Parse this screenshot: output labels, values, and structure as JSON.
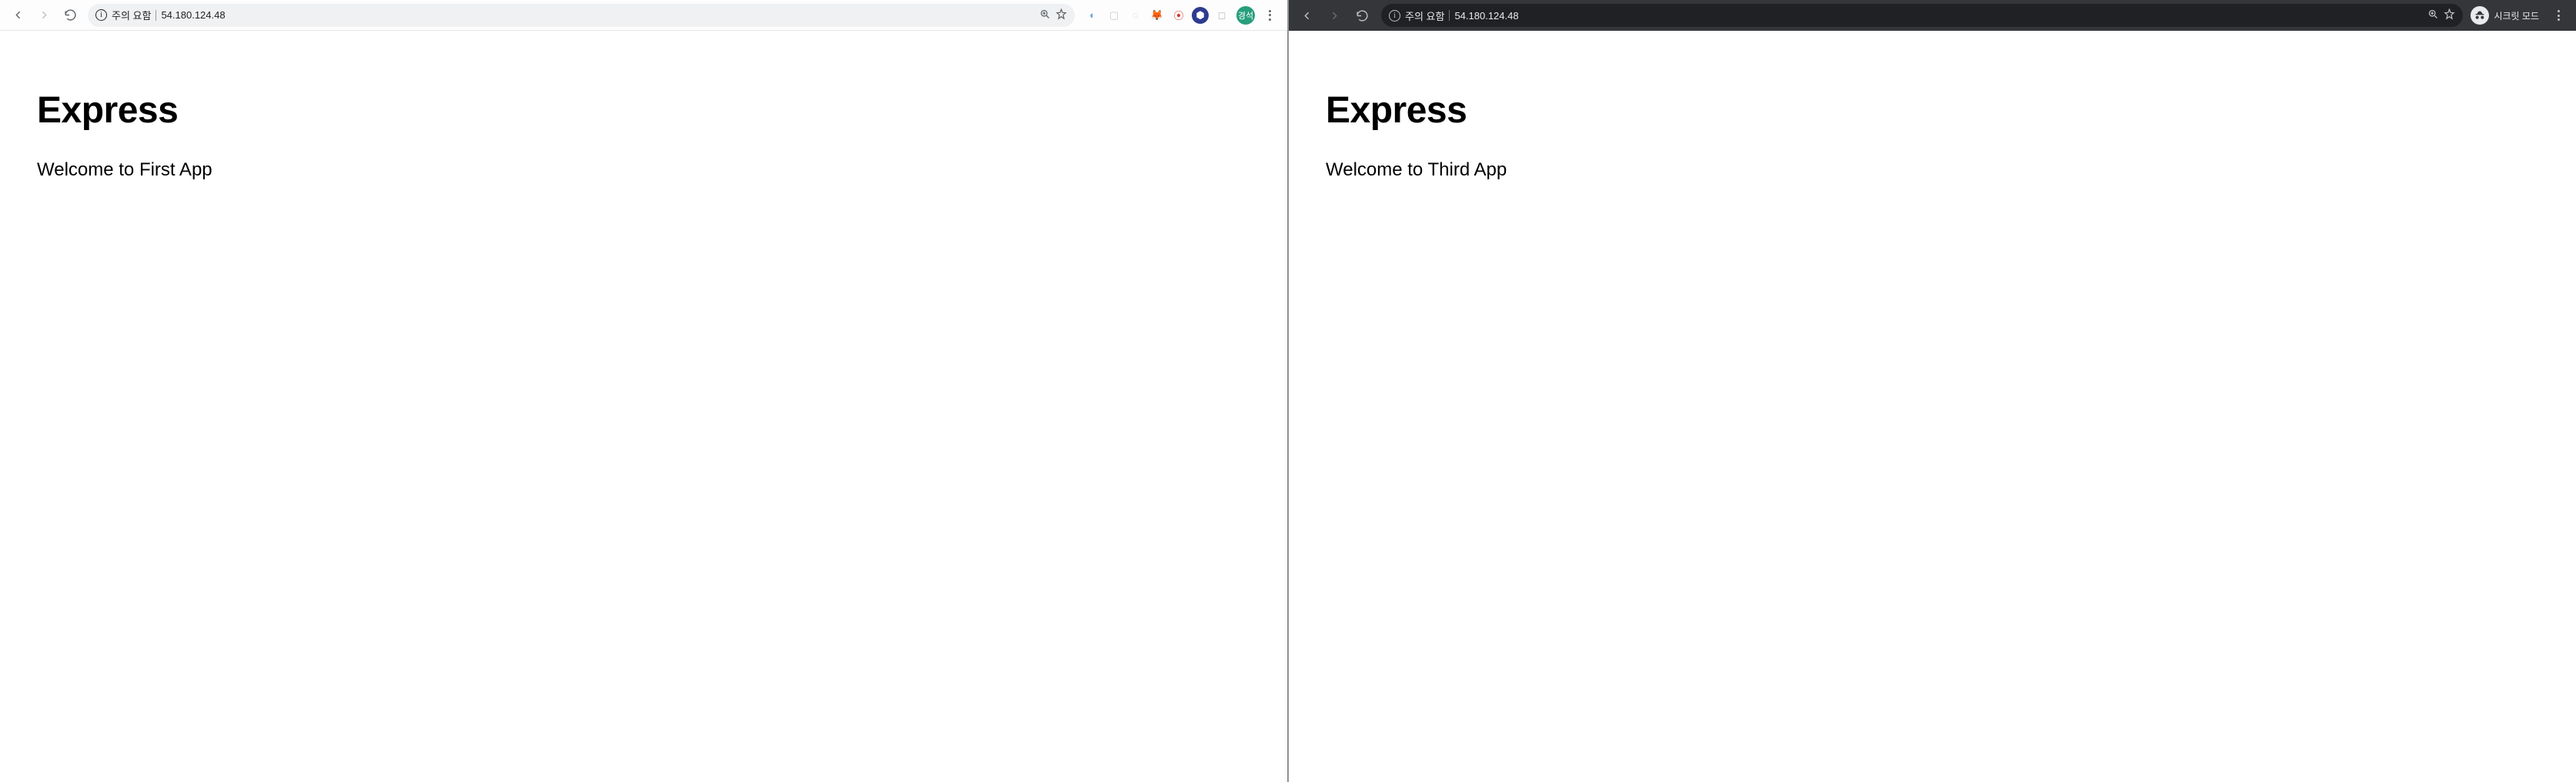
{
  "left": {
    "omnibar": {
      "notice": "주의 요함",
      "url": "54.180.124.48"
    },
    "page": {
      "heading": "Express",
      "welcome": "Welcome to First App"
    },
    "profile": {
      "label": "경석",
      "bg": "#279e7c"
    },
    "ext_icons": {
      "i1": {
        "glyph": "◐",
        "color": "#6aa3e0"
      },
      "i2": {
        "glyph": "▢",
        "color": "#c9c9c9"
      },
      "i3": {
        "glyph": "◌",
        "color": "#c9c9c9"
      },
      "i4": {
        "glyph": "🦊",
        "color": "#e2761b"
      },
      "i5": {
        "glyph": "⦿",
        "color": "#d43a2f"
      },
      "i6": {
        "glyph": "⬢",
        "color": "#2e3b8f"
      },
      "i7": {
        "glyph": "◻",
        "color": "#bdbdbd"
      }
    }
  },
  "right": {
    "omnibar": {
      "notice": "주의 요함",
      "url": "54.180.124.48"
    },
    "incognito_label": "시크릿 모드",
    "page": {
      "heading": "Express",
      "welcome": "Welcome to Third App"
    }
  }
}
